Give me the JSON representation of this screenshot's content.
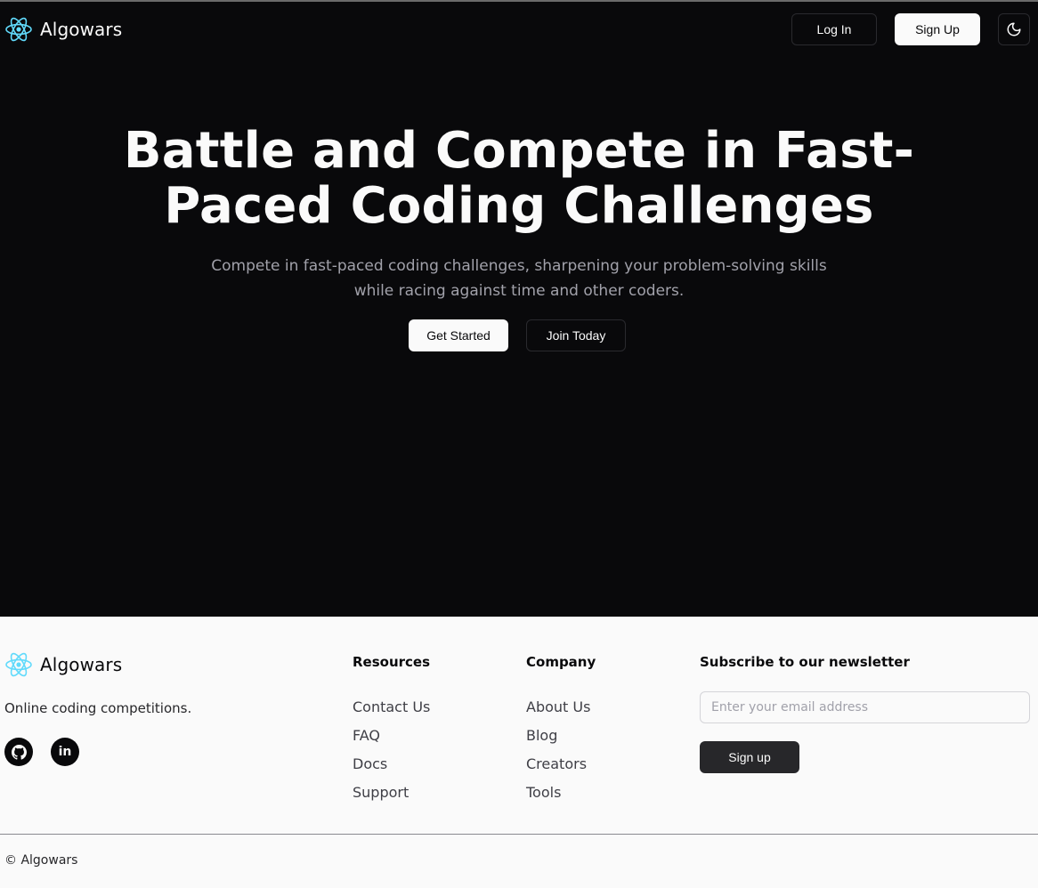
{
  "brand": {
    "name": "Algowars",
    "accent_color": "#61dafb",
    "logo_icon": "atom-icon"
  },
  "nav": {
    "login_label": "Log In",
    "signup_label": "Sign Up",
    "theme_toggle_icon": "moon-icon"
  },
  "hero": {
    "title_line1": "Battle and Compete in Fast-",
    "title_line2": "Paced Coding Challenges",
    "subtitle_line1": "Compete in fast-paced coding challenges, sharpening your problem-solving skills",
    "subtitle_line2": "while racing against time and other coders.",
    "primary_cta": "Get Started",
    "secondary_cta": "Join Today"
  },
  "footer": {
    "brand": "Algowars",
    "tagline": "Online coding competitions.",
    "social_icons": [
      "github-icon",
      "linkedin-icon"
    ],
    "linkedin_glyph": "in",
    "resources": {
      "heading": "Resources",
      "links": [
        "Contact Us",
        "FAQ",
        "Docs",
        "Support"
      ]
    },
    "company": {
      "heading": "Company",
      "links": [
        "About Us",
        "Blog",
        "Creators",
        "Tools"
      ]
    },
    "newsletter": {
      "heading": "Subscribe to our newsletter",
      "placeholder": "Enter your email address",
      "button_label": "Sign up"
    },
    "copyright": "© Algowars"
  },
  "colors": {
    "hero_bg": "#09090b",
    "footer_bg": "#fafafa",
    "text_light": "#fafafa",
    "muted": "#a1a1aa"
  }
}
